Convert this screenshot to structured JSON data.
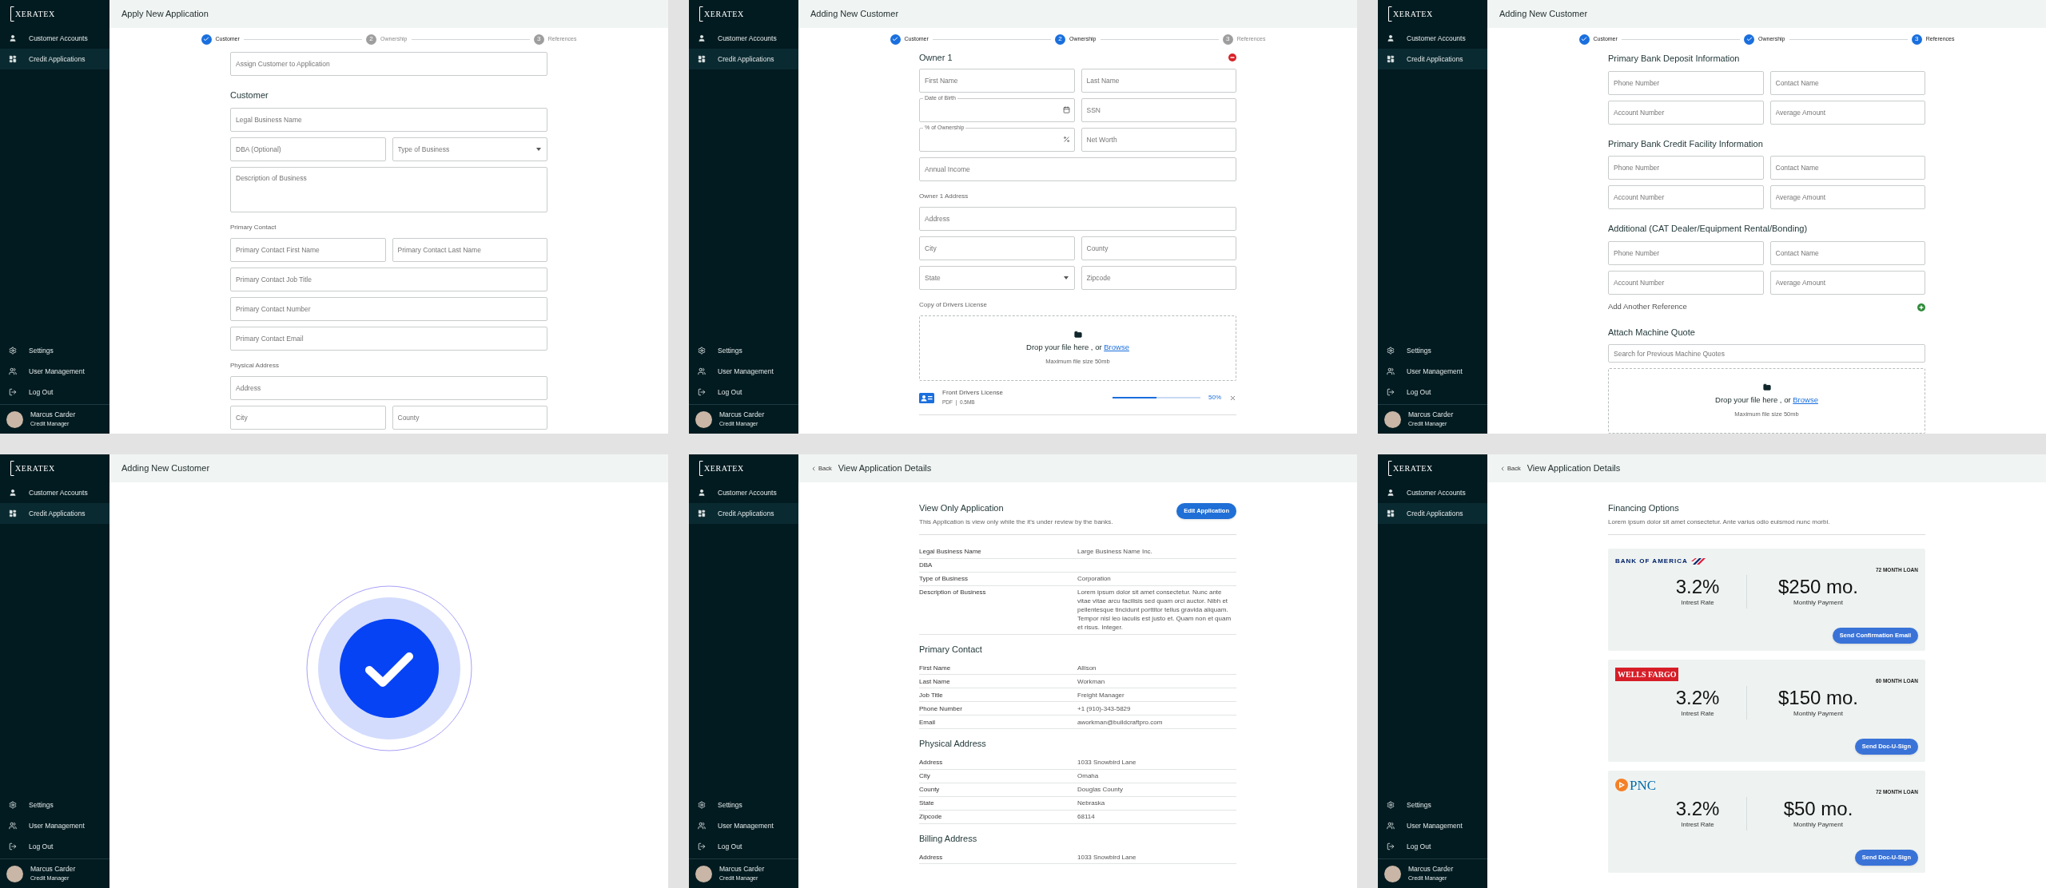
{
  "panels": [
    {
      "sidebar": {
        "logo": "XERATEX",
        "nav": [
          {
            "label": "Customer Accounts",
            "selected": false
          },
          {
            "label": "Credit Applications",
            "selected": true
          }
        ],
        "footer_nav": [
          "Settings",
          "User Management",
          "Log Out"
        ],
        "user": {
          "name": "Marcus Carder",
          "role": "Credit Manager"
        }
      },
      "header": {
        "title": "Apply New Application"
      },
      "stepper": {
        "steps": [
          {
            "kind": "done",
            "label": "Customer"
          },
          {
            "kind": "pending",
            "number": "2",
            "label": "Ownership"
          },
          {
            "kind": "pending",
            "number": "3",
            "label": "References"
          }
        ]
      },
      "body": [
        {
          "kind": "field",
          "field": {
            "kind": "text",
            "placeholder": "Assign Customer to Application"
          }
        },
        {
          "kind": "heading",
          "text": "Customer"
        },
        {
          "kind": "field",
          "field": {
            "kind": "text",
            "placeholder": "Legal Business Name"
          }
        },
        {
          "kind": "row",
          "fields": [
            {
              "kind": "text",
              "placeholder": "DBA (Optional)"
            },
            {
              "kind": "select",
              "placeholder": "Type of Business"
            }
          ]
        },
        {
          "kind": "field",
          "field": {
            "kind": "textarea",
            "placeholder": "Description of Business"
          }
        },
        {
          "kind": "subheading",
          "text": "Primary Contact"
        },
        {
          "kind": "row",
          "fields": [
            {
              "kind": "text",
              "placeholder": "Primary Contact First Name"
            },
            {
              "kind": "text",
              "placeholder": "Primary Contact Last Name"
            }
          ]
        },
        {
          "kind": "field",
          "field": {
            "kind": "text",
            "placeholder": "Primary Contact Job Title"
          }
        },
        {
          "kind": "field",
          "field": {
            "kind": "text",
            "placeholder": "Primary Contact Number"
          }
        },
        {
          "kind": "field",
          "field": {
            "kind": "text",
            "placeholder": "Primary Contact Email"
          }
        },
        {
          "kind": "subheading",
          "text": "Physical Address"
        },
        {
          "kind": "field",
          "field": {
            "kind": "text",
            "placeholder": "Address"
          }
        },
        {
          "kind": "row",
          "fields": [
            {
              "kind": "text",
              "placeholder": "City"
            },
            {
              "kind": "text",
              "placeholder": "County"
            }
          ]
        }
      ]
    },
    {
      "sidebar": {
        "logo": "XERATEX",
        "nav": [
          {
            "label": "Customer Accounts",
            "selected": false
          },
          {
            "label": "Credit Applications",
            "selected": true
          }
        ],
        "footer_nav": [
          "Settings",
          "User Management",
          "Log Out"
        ],
        "user": {
          "name": "Marcus Carder",
          "role": "Credit Manager"
        }
      },
      "header": {
        "title": "Adding New Customer"
      },
      "stepper": {
        "steps": [
          {
            "kind": "done",
            "label": "Customer"
          },
          {
            "kind": "current",
            "number": "2",
            "label": "Ownership"
          },
          {
            "kind": "pending",
            "number": "3",
            "label": "References"
          }
        ]
      },
      "body": [
        {
          "kind": "owner_title",
          "text": "Owner 1"
        },
        {
          "kind": "row",
          "fields": [
            {
              "kind": "text",
              "placeholder": "First Name"
            },
            {
              "kind": "text",
              "placeholder": "Last Name"
            }
          ]
        },
        {
          "kind": "row",
          "fields": [
            {
              "kind": "date",
              "label": "Date of Birth"
            },
            {
              "kind": "text",
              "placeholder": "SSN"
            }
          ]
        },
        {
          "kind": "row",
          "fields": [
            {
              "kind": "percent",
              "label": "% of Ownership"
            },
            {
              "kind": "text",
              "placeholder": "Net Worth"
            }
          ]
        },
        {
          "kind": "field",
          "field": {
            "kind": "text",
            "placeholder": "Annual Income"
          }
        },
        {
          "kind": "subheading",
          "text": "Owner 1 Address"
        },
        {
          "kind": "field",
          "field": {
            "kind": "text",
            "placeholder": "Address"
          }
        },
        {
          "kind": "row",
          "fields": [
            {
              "kind": "text",
              "placeholder": "City"
            },
            {
              "kind": "text",
              "placeholder": "County"
            }
          ]
        },
        {
          "kind": "row",
          "fields": [
            {
              "kind": "select",
              "placeholder": "State"
            },
            {
              "kind": "text",
              "placeholder": "Zipcode"
            }
          ]
        },
        {
          "kind": "subheading",
          "text": "Copy of Drivers License"
        },
        {
          "kind": "dropzone",
          "prompt": "Drop your file here , or",
          "link": "Browse",
          "note": "Maximum file size 50mb"
        },
        {
          "kind": "upload",
          "name": "Front Drivers License",
          "meta": "PDF  |  0.5MB",
          "level": 0.5,
          "percent": "50%"
        }
      ]
    },
    {
      "sidebar": {
        "logo": "XERATEX",
        "nav": [
          {
            "label": "Customer Accounts",
            "selected": false
          },
          {
            "label": "Credit Applications",
            "selected": true
          }
        ],
        "footer_nav": [
          "Settings",
          "User Management",
          "Log Out"
        ],
        "user": {
          "name": "Marcus Carder",
          "role": "Credit Manager"
        }
      },
      "header": {
        "title": "Adding New Customer"
      },
      "stepper": {
        "steps": [
          {
            "kind": "done",
            "label": "Customer"
          },
          {
            "kind": "done",
            "label": "Ownership"
          },
          {
            "kind": "current",
            "number": "3",
            "label": "References"
          }
        ]
      },
      "body": [
        {
          "kind": "heading",
          "text": "Primary Bank Deposit Information"
        },
        {
          "kind": "row",
          "fields": [
            {
              "kind": "text",
              "placeholder": "Phone Number"
            },
            {
              "kind": "text",
              "placeholder": "Contact Name"
            }
          ]
        },
        {
          "kind": "row",
          "fields": [
            {
              "kind": "text",
              "placeholder": "Account Number"
            },
            {
              "kind": "text",
              "placeholder": "Average Amount"
            }
          ]
        },
        {
          "kind": "heading",
          "text": "Primary Bank Credit Facility Information"
        },
        {
          "kind": "row",
          "fields": [
            {
              "kind": "text",
              "placeholder": "Phone Number"
            },
            {
              "kind": "text",
              "placeholder": "Contact Name"
            }
          ]
        },
        {
          "kind": "row",
          "fields": [
            {
              "kind": "text",
              "placeholder": "Account Number"
            },
            {
              "kind": "text",
              "placeholder": "Average Amount"
            }
          ]
        },
        {
          "kind": "heading",
          "text": "Additional (CAT Dealer/Equipment Rental/Bonding)"
        },
        {
          "kind": "row",
          "fields": [
            {
              "kind": "text",
              "placeholder": "Phone Number"
            },
            {
              "kind": "text",
              "placeholder": "Contact Name"
            }
          ]
        },
        {
          "kind": "row",
          "fields": [
            {
              "kind": "text",
              "placeholder": "Account Number"
            },
            {
              "kind": "text",
              "placeholder": "Average Amount"
            }
          ]
        },
        {
          "kind": "add_row",
          "text": "Add Another Reference"
        },
        {
          "kind": "heading",
          "text": "Attach Machine Quote"
        },
        {
          "kind": "field",
          "field": {
            "kind": "text",
            "placeholder": "Search for Previous Machine Quotes"
          }
        },
        {
          "kind": "dropzone",
          "prompt": "Drop your file here , or",
          "link": "Browse",
          "note": "Maximum file size 50mb"
        }
      ]
    },
    {
      "sidebar": {
        "logo": "XERATEX",
        "nav": [
          {
            "label": "Customer Accounts",
            "selected": false
          },
          {
            "label": "Credit Applications",
            "selected": true
          }
        ],
        "footer_nav": [
          "Settings",
          "User Management",
          "Log Out"
        ],
        "user": {
          "name": "Marcus Carder",
          "role": "Credit Manager"
        }
      },
      "header": {
        "title": "Adding New Customer"
      },
      "body": [
        {
          "kind": "success"
        }
      ]
    },
    {
      "sidebar": {
        "logo": "XERATEX",
        "nav": [
          {
            "label": "Customer Accounts",
            "selected": false
          },
          {
            "label": "Credit Applications",
            "selected": true
          }
        ],
        "footer_nav": [
          "Settings",
          "User Management",
          "Log Out"
        ],
        "user": {
          "name": "Marcus Carder",
          "role": "Credit Manager"
        }
      },
      "header": {
        "back": "Back",
        "title": "View Application Details"
      },
      "body": [
        {
          "kind": "intro",
          "title": "View Only Application",
          "description": "This Application is view only while the it's under review by the banks.",
          "button": "Edit Application"
        },
        {
          "kind": "details",
          "rows": [
            {
              "label": "Legal Business Name",
              "value": "Large Business Name Inc."
            },
            {
              "label": "DBA"
            },
            {
              "label": "Type of Business",
              "value": "Corporation"
            },
            {
              "label": "Description of Business",
              "value": "Lorem ipsum dolor sit amet consectetur. Nunc ante vitae vitae arcu facilisis sed quam orci auctor. Nibh et pellentesque tincidunt porttitor tellus gravida aliquam. Tempor nisl leo iaculis est justo et. Quam non et quam et risus. Integer."
            }
          ]
        },
        {
          "kind": "section",
          "text": "Primary Contact"
        },
        {
          "kind": "details",
          "rows": [
            {
              "label": "First Name",
              "value": "Allison"
            },
            {
              "label": "Last Name",
              "value": "Workman"
            },
            {
              "label": "Job Title",
              "value": "Freight Manager"
            },
            {
              "label": "Phone Number",
              "value": "+1 (910)-343-5829"
            },
            {
              "label": "Email",
              "value": "aworkman@buildcraftpro.com"
            }
          ]
        },
        {
          "kind": "section",
          "text": "Physical Address"
        },
        {
          "kind": "details",
          "rows": [
            {
              "label": "Address",
              "value": "1033 Snowbird Lane"
            },
            {
              "label": "City",
              "value": "Omaha"
            },
            {
              "label": "County",
              "value": "Douglas County"
            },
            {
              "label": "State",
              "value": "Nebraska"
            },
            {
              "label": "Zipcode",
              "value": "68114"
            }
          ]
        },
        {
          "kind": "section",
          "text": "Billing Address"
        },
        {
          "kind": "details",
          "rows": [
            {
              "label": "Address",
              "value": "1033 Snowbird Lane"
            }
          ]
        }
      ]
    },
    {
      "sidebar": {
        "logo": "XERATEX",
        "nav": [
          {
            "label": "Customer Accounts",
            "selected": false
          },
          {
            "label": "Credit Applications",
            "selected": true
          }
        ],
        "footer_nav": [
          "Settings",
          "User Management",
          "Log Out"
        ],
        "user": {
          "name": "Marcus Carder",
          "role": "Credit Manager"
        }
      },
      "header": {
        "back": "Back",
        "title": "View Application Details"
      },
      "body": [
        {
          "kind": "intro",
          "title": "Financing Options",
          "description": "Lorem ipsum dolor sit amet consectetur. Ante varius odio euismod nunc morbi."
        },
        {
          "kind": "loan",
          "logo": {
            "kind": "flag",
            "text": "BANK OF AMERICA"
          },
          "term": "72 MONTH LOAN",
          "rate": "3.2%",
          "rate_label": "Intrest Rate",
          "payment": "$250 mo.",
          "payment_label": "Monthly Payment",
          "button": "Send Confirmation Email"
        },
        {
          "kind": "loan",
          "logo": {
            "kind": "boxed",
            "text": "WELLS FARGO"
          },
          "term": "60 MONTH LOAN",
          "rate": "3.2%",
          "rate_label": "Intrest Rate",
          "payment": "$150 mo.",
          "payment_label": "Monthly Payment",
          "button": "Send Doc-U-Sign"
        },
        {
          "kind": "loan",
          "logo": {
            "kind": "mark",
            "text": "PNC"
          },
          "term": "72 MONTH LOAN",
          "rate": "3.2%",
          "rate_label": "Intrest Rate",
          "payment": "$50 mo.",
          "payment_label": "Monthly Payment",
          "button": "Send Doc-U-Sign"
        }
      ]
    }
  ]
}
